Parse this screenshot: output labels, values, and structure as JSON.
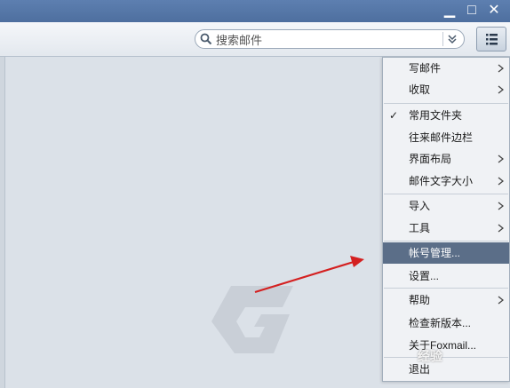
{
  "window": {
    "minimize_glyph": "▁",
    "maximize_glyph": "□",
    "close_glyph": "✕"
  },
  "search": {
    "placeholder": "搜索邮件"
  },
  "menu": {
    "items": [
      {
        "label": "写邮件",
        "submenu": true
      },
      {
        "label": "收取",
        "submenu": true
      },
      {
        "label": "常用文件夹",
        "checked": true,
        "check_glyph": "✓"
      },
      {
        "label": "往来邮件边栏"
      },
      {
        "label": "界面布局",
        "submenu": true
      },
      {
        "label": "邮件文字大小",
        "submenu": true
      },
      {
        "label": "导入",
        "submenu": true
      },
      {
        "label": "工具",
        "submenu": true
      },
      {
        "label": "帐号管理...",
        "highlighted": true
      },
      {
        "label": "设置..."
      },
      {
        "label": "帮助",
        "submenu": true
      },
      {
        "label": "检查新版本..."
      },
      {
        "label": "关于Foxmail..."
      },
      {
        "label": "退出"
      }
    ]
  },
  "watermark": {
    "text": "经验"
  },
  "colors": {
    "titlebar": "#4e6f9f",
    "highlight": "#5b6e88",
    "annotation_arrow": "#d42020"
  }
}
